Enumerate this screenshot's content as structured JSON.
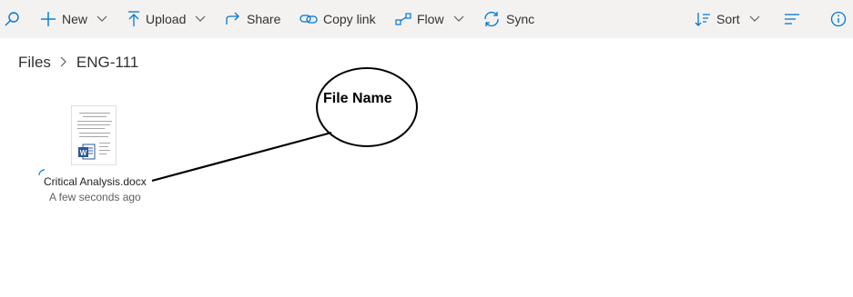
{
  "toolbar": {
    "new_label": "New",
    "upload_label": "Upload",
    "share_label": "Share",
    "copy_link_label": "Copy link",
    "flow_label": "Flow",
    "sync_label": "Sync",
    "sort_label": "Sort",
    "icons": [
      "search-icon",
      "plus-icon",
      "chevron-down-icon",
      "upload-arrow-icon",
      "share-icon",
      "link-icon",
      "flow-icon",
      "sync-icon",
      "sort-icon",
      "view-options-icon",
      "info-icon"
    ]
  },
  "breadcrumb": {
    "root": "Files",
    "current": "ENG-111"
  },
  "file": {
    "name": "Critical Analysis.docx",
    "modified": "A few seconds ago",
    "type_icon": "word-icon"
  },
  "annotation": {
    "label": "File Name"
  },
  "colors": {
    "accent": "#0078d4",
    "toolbar_bg": "#f3f2f1",
    "word_blue": "#2b579a"
  }
}
